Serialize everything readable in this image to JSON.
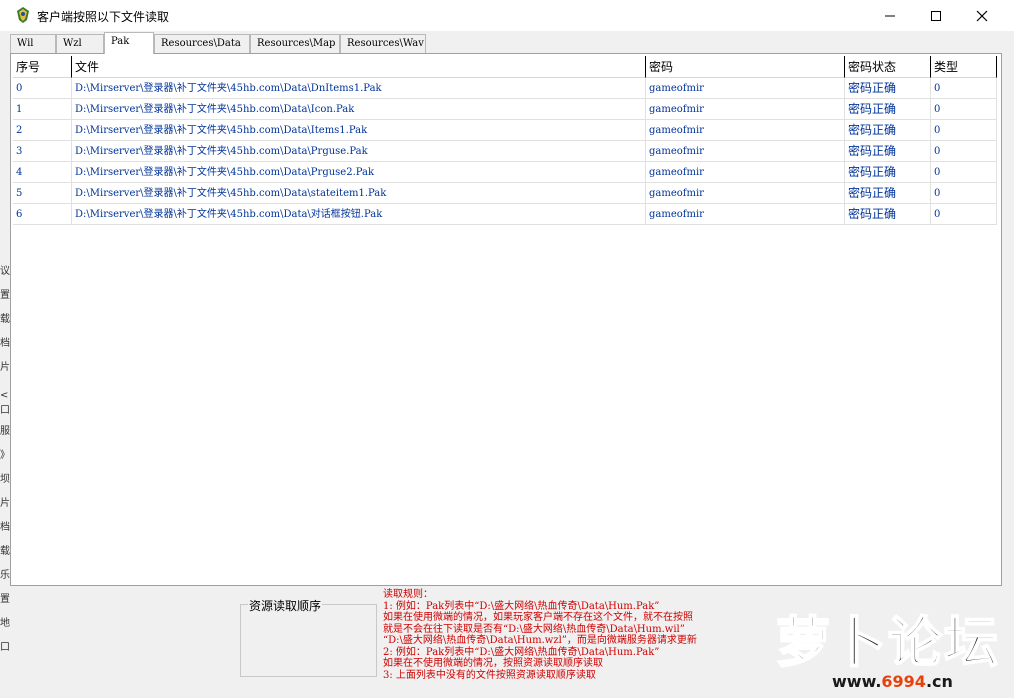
{
  "window": {
    "title": "客户端按照以下文件读取",
    "minimize": "—",
    "maximize": "☐",
    "close": "✕"
  },
  "tabs": [
    {
      "label": "Wil"
    },
    {
      "label": "Wzl"
    },
    {
      "label": "Pak"
    },
    {
      "label": "Resources\\Data"
    },
    {
      "label": "Resources\\Map"
    },
    {
      "label": "Resources\\Wav"
    }
  ],
  "table": {
    "headers": [
      "序号",
      "文件",
      "密码",
      "密码状态",
      "类型"
    ],
    "rows": [
      {
        "index": "0",
        "file": "D:\\Mirserver\\登录器\\补丁文件夹\\45hb.com\\Data\\DnItems1.Pak",
        "password": "gameofmir",
        "status": "密码正确",
        "type": "0"
      },
      {
        "index": "1",
        "file": "D:\\Mirserver\\登录器\\补丁文件夹\\45hb.com\\Data\\Icon.Pak",
        "password": "gameofmir",
        "status": "密码正确",
        "type": "0"
      },
      {
        "index": "2",
        "file": "D:\\Mirserver\\登录器\\补丁文件夹\\45hb.com\\Data\\Items1.Pak",
        "password": "gameofmir",
        "status": "密码正确",
        "type": "0"
      },
      {
        "index": "3",
        "file": "D:\\Mirserver\\登录器\\补丁文件夹\\45hb.com\\Data\\Prguse.Pak",
        "password": "gameofmir",
        "status": "密码正确",
        "type": "0"
      },
      {
        "index": "4",
        "file": "D:\\Mirserver\\登录器\\补丁文件夹\\45hb.com\\Data\\Prguse2.Pak",
        "password": "gameofmir",
        "status": "密码正确",
        "type": "0"
      },
      {
        "index": "5",
        "file": "D:\\Mirserver\\登录器\\补丁文件夹\\45hb.com\\Data\\stateitem1.Pak",
        "password": "gameofmir",
        "status": "密码正确",
        "type": "0"
      },
      {
        "index": "6",
        "file": "D:\\Mirserver\\登录器\\补丁文件夹\\45hb.com\\Data\\对话框按钮.Pak",
        "password": "gameofmir",
        "status": "密码正确",
        "type": "0"
      }
    ]
  },
  "resource_order": {
    "title": "资源读取顺序"
  },
  "rules": {
    "lines": [
      "读取规则：",
      "1: 例如：Pak列表中“D:\\盛大网络\\热血传奇\\Data\\Hum.Pak”",
      "    如果在使用微端的情况，如果玩家客户端不存在这个文件，就不在按照",
      "    就是不会在往下读取是否有“D:\\盛大网络\\热血传奇\\Data\\Hum.wil”",
      "  “D:\\盛大网络\\热血传奇\\Data\\Hum.wzl”，而是向微端服务器请求更新",
      "2: 例如：Pak列表中“D:\\盛大网络\\热血传奇\\Data\\Hum.Pak”",
      "    如果在不使用微端的情况，按照资源读取顺序读取",
      "3: 上面列表中没有的文件按照资源读取顺序读取"
    ]
  },
  "left_strip": [
    "议",
    "置",
    "载",
    "档",
    "片",
    "<口",
    "服",
    "》",
    "坝",
    "片",
    "档",
    "载",
    "乐",
    "置",
    "地",
    "口"
  ],
  "watermark": {
    "logo_text": "萝卜论坛",
    "url_prefix": "www.",
    "url_number": "6994",
    "url_suffix": ".cn"
  }
}
